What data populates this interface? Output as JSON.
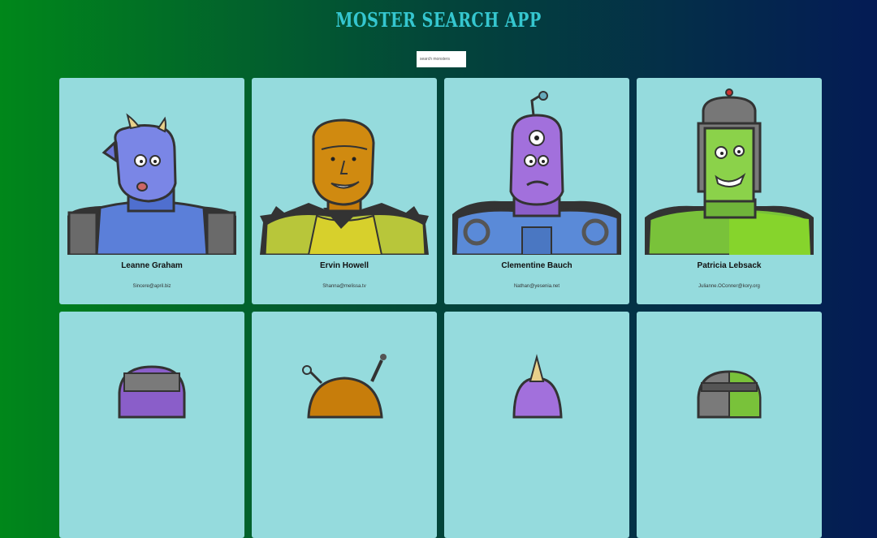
{
  "app": {
    "title": "MOSTER SEARCH APP"
  },
  "search": {
    "placeholder": "search monsters",
    "value": ""
  },
  "monsters": [
    {
      "name": "Leanne Graham",
      "email": "Sincere@april.biz"
    },
    {
      "name": "Ervin Howell",
      "email": "Shanna@melissa.tv"
    },
    {
      "name": "Clementine Bauch",
      "email": "Nathan@yesenia.net"
    },
    {
      "name": "Patricia Lebsack",
      "email": "Julianne.OConner@kory.org"
    },
    {
      "name": "",
      "email": ""
    },
    {
      "name": "",
      "email": ""
    },
    {
      "name": "",
      "email": ""
    },
    {
      "name": "",
      "email": ""
    }
  ],
  "colors": {
    "title": "#35c6cf",
    "card_background": "#95dbdd",
    "bg_left": "#00871a",
    "bg_right": "#041b55"
  }
}
